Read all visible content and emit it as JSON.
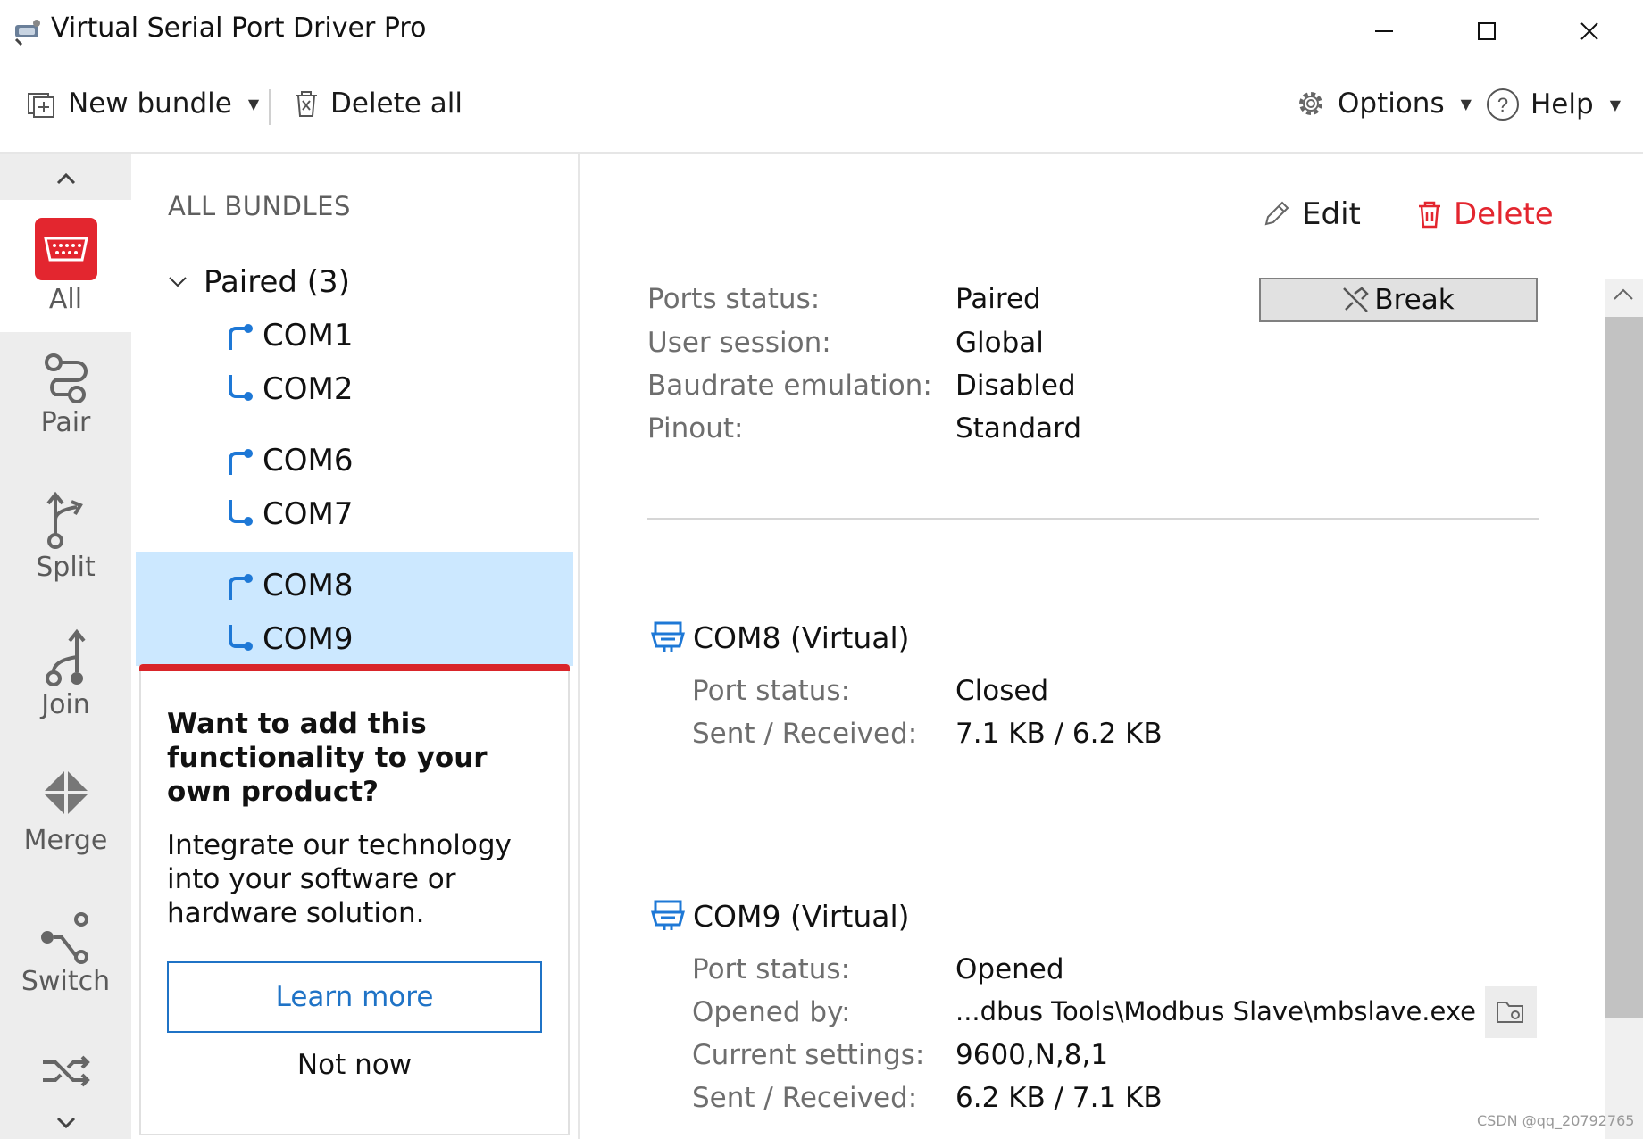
{
  "window": {
    "title": "Virtual Serial Port Driver Pro",
    "app_icon": "serial-port-app-icon"
  },
  "toolbar": {
    "new_bundle": "New bundle",
    "delete_all": "Delete all",
    "options": "Options",
    "help": "Help"
  },
  "nav": {
    "items": [
      {
        "label": "All",
        "icon": "serial-port-icon",
        "active": true
      },
      {
        "label": "Pair",
        "icon": "pair-icon"
      },
      {
        "label": "Split",
        "icon": "split-icon"
      },
      {
        "label": "Join",
        "icon": "join-icon"
      },
      {
        "label": "Merge",
        "icon": "merge-icon"
      },
      {
        "label": "Switch",
        "icon": "switch-icon"
      }
    ],
    "accent": "#e3262f"
  },
  "bundles": {
    "header": "ALL BUNDLES",
    "group": "Paired (3)",
    "pairs": [
      [
        "COM1",
        "COM2"
      ],
      [
        "COM6",
        "COM7"
      ],
      [
        "COM8",
        "COM9"
      ]
    ]
  },
  "promo": {
    "title": "Want to add this functionality to your own product?",
    "body": "Integrate our technology into your software or hardware solution.",
    "learn_more": "Learn more",
    "not_now": "Not now"
  },
  "details": {
    "edit": "Edit",
    "delete": "Delete",
    "break": "Break",
    "rows": [
      {
        "label": "Ports status:",
        "value": "Paired"
      },
      {
        "label": "User session:",
        "value": "Global"
      },
      {
        "label": "Baudrate emulation:",
        "value": "Disabled"
      },
      {
        "label": "Pinout:",
        "value": "Standard"
      }
    ],
    "port_a": {
      "title": "COM8 (Virtual)",
      "rows": [
        {
          "label": "Port status:",
          "value": "Closed"
        },
        {
          "label": "Sent / Received:",
          "value": "7.1 KB / 6.2 KB"
        }
      ]
    },
    "port_b": {
      "title": "COM9 (Virtual)",
      "rows": [
        {
          "label": "Port status:",
          "value": "Opened"
        },
        {
          "label": "Opened by:",
          "value": "...dbus Tools\\Modbus Slave\\mbslave.exe"
        },
        {
          "label": "Current settings:",
          "value": "9600,N,8,1"
        },
        {
          "label": "Sent / Received:",
          "value": "6.2 KB / 7.1 KB"
        }
      ]
    }
  },
  "colors": {
    "delete_red": "#e3262f",
    "link_blue": "#1f73c6",
    "selection": "#cce8ff",
    "port_blue": "#1e78d6"
  },
  "watermark": "CSDN @qq_20792765"
}
